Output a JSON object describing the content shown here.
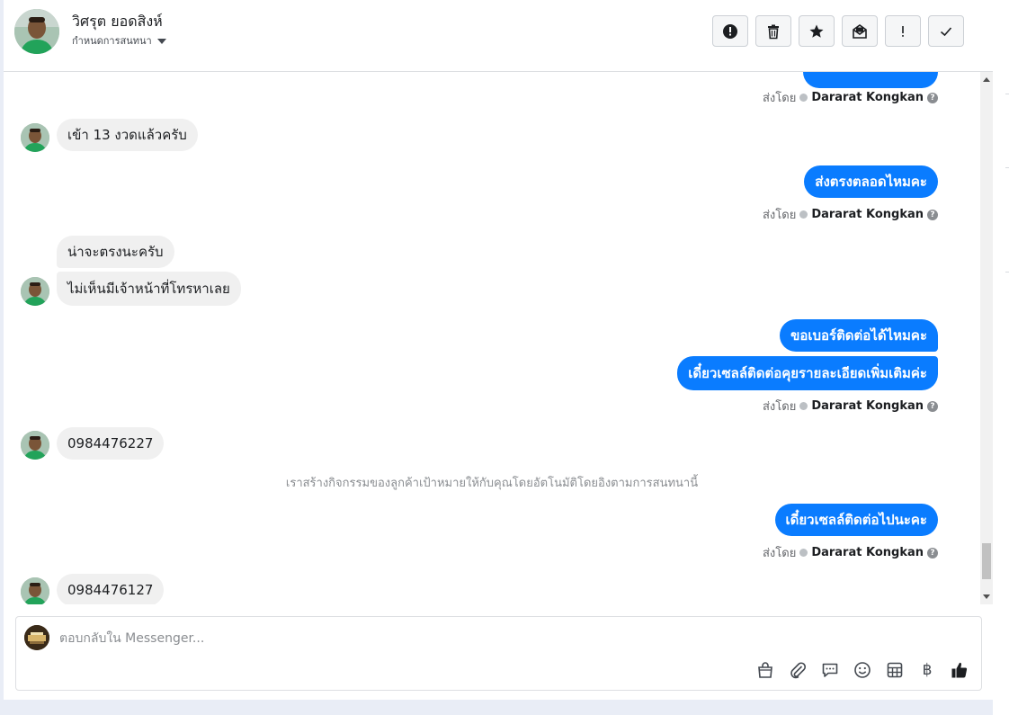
{
  "header": {
    "contact_name": "วิศรุต ยอดสิงห์",
    "assign_label": "กำหนดการสนทนา",
    "actions": [
      {
        "icon": "alert-circle-icon",
        "name": "mark-spam-button"
      },
      {
        "icon": "trash-icon",
        "name": "delete-button"
      },
      {
        "icon": "star-icon",
        "name": "star-button"
      },
      {
        "icon": "mail-envelope-icon",
        "name": "mark-unread-button"
      },
      {
        "icon": "exclamation-icon",
        "name": "follow-up-button"
      },
      {
        "icon": "checkmark-icon",
        "name": "mark-done-button"
      }
    ]
  },
  "conversation": {
    "sent_by_prefix": "ส่งโดย",
    "agent_name": "Dararat Kongkan",
    "messages": {
      "in_1": "เข้า 13 งวดแล้วครับ",
      "out_1": "ส่งตรงตลอดไหมคะ",
      "in_2a": "น่าจะตรงนะครับ",
      "in_2b": "ไม่เห็นมีเจ้าหน้าที่โทรหาเลย",
      "out_2a": "ขอเบอร์ติดต่อได้ไหมคะ",
      "out_2b": "เดี๋ยวเซลล์ติดต่อคุยรายละเอียดเพิ่มเติมค่ะ",
      "in_3": "0984476227",
      "system_note": "เราสร้างกิจกรรมของลูกค้าเป้าหมายให้กับคุณโดยอัตโนมัติโดยอิงตามการสนทนานี้",
      "out_3": "เดี๋ยวเซลล์ติดต่อไปนะคะ",
      "in_4": "0984476127"
    }
  },
  "composer": {
    "placeholder": "ตอบกลับใน Messenger...",
    "tools": [
      "shopping-bag-icon",
      "paperclip-icon",
      "saved-reply-icon",
      "emoji-icon",
      "table-icon",
      "baht-icon",
      "thumbs-up-icon"
    ],
    "currency_symbol": "฿"
  },
  "colors": {
    "outgoing_bubble": "#0a7cff",
    "incoming_bubble": "#f0f0f0",
    "page_background": "#e9edf6"
  }
}
